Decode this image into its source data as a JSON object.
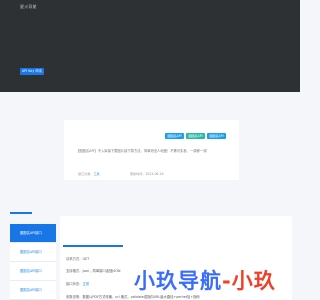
{
  "header": {
    "logo": "星火导航",
    "button": "API Key 申请"
  },
  "card": {
    "tags": [
      "图图名API",
      "图图名API",
      "图图名API"
    ],
    "description": "【图图名API】不入库接下载图片接下算方法，简单而没人地做！不需可实参，一调即一调",
    "updated_label": "接口分类：",
    "updated_value": "工具",
    "date_label": "更新时间：",
    "date_value": "2024-06-16"
  },
  "sidebar": {
    "items": [
      {
        "label": "图图名API接口"
      },
      {
        "label": "图图名API接口"
      },
      {
        "label": "图图名API接口"
      },
      {
        "label": "图图名API接口"
      }
    ]
  },
  "info": {
    "rows": [
      {
        "label": "请求方式：",
        "value": "GET"
      },
      {
        "label": "支持格式：",
        "value": "json，简单接口返回JSON"
      },
      {
        "label": "接口状态：",
        "value": "正常"
      },
      {
        "label": "参数说明：",
        "value": "数图以PDF方式传输，url 格式，validate或指向URL最大路径+perhet加+指码"
      }
    ]
  },
  "watermark": {
    "blue": "小玖导航",
    "red": "-小玖"
  },
  "colors": {
    "accent": "#1976e6",
    "teal": "#28b9a2",
    "banner": "#2e3133",
    "watermark_blue": "#3b6dfa",
    "watermark_red": "#f0402a"
  }
}
